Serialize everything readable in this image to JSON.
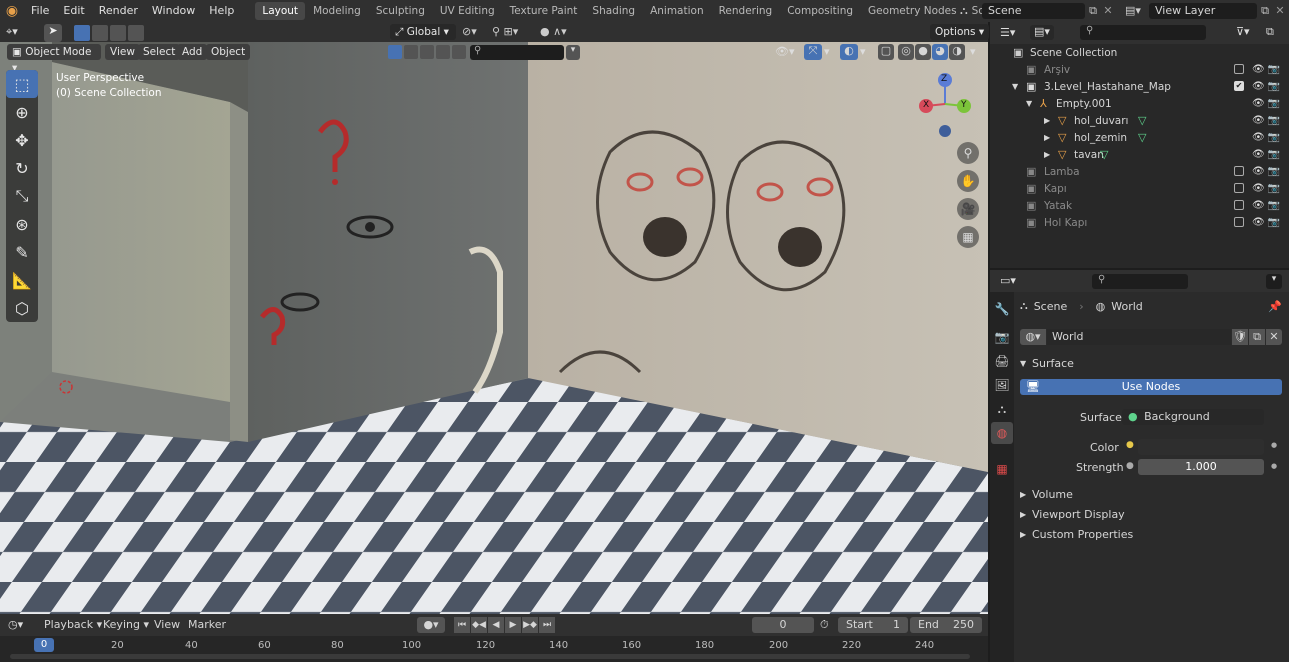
{
  "menubar": {
    "items": [
      "File",
      "Edit",
      "Render",
      "Window",
      "Help"
    ],
    "workspaces": [
      "Layout",
      "Modeling",
      "Sculpting",
      "UV Editing",
      "Texture Paint",
      "Shading",
      "Animation",
      "Rendering",
      "Compositing",
      "Geometry Nodes",
      "Scripting"
    ],
    "active_workspace": "Layout",
    "add_tab": "+",
    "scene_name": "Scene",
    "view_layer": "View Layer"
  },
  "viewport_header": {
    "mode": "Object Mode",
    "menus": [
      "View",
      "Select",
      "Add",
      "Object"
    ],
    "transform_orientation": "Global",
    "options": "Options"
  },
  "viewport": {
    "view_name": "User Perspective",
    "collection": "(0) Scene Collection",
    "gizmo_axes": {
      "x": "X",
      "y": "Y",
      "z": "Z"
    }
  },
  "outliner": {
    "root": "Scene Collection",
    "items": [
      {
        "label": "Arşiv",
        "indent": 0,
        "dim": true
      },
      {
        "label": "3.Level_Hastahane_Map",
        "indent": 0,
        "dim": false
      },
      {
        "label": "Empty.001",
        "indent": 1,
        "dim": false
      },
      {
        "label": "hol_duvarı",
        "indent": 2,
        "dim": false
      },
      {
        "label": "hol_zemin",
        "indent": 2,
        "dim": false
      },
      {
        "label": "tavan",
        "indent": 2,
        "dim": false
      },
      {
        "label": "Lamba",
        "indent": 0,
        "dim": true
      },
      {
        "label": "Kapı",
        "indent": 0,
        "dim": true
      },
      {
        "label": "Yatak",
        "indent": 0,
        "dim": true
      },
      {
        "label": "Hol Kapı",
        "indent": 0,
        "dim": true
      }
    ]
  },
  "properties": {
    "breadcrumb_scene": "Scene",
    "breadcrumb_world": "World",
    "world_name": "World",
    "surface_panel": "Surface",
    "use_nodes": "Use Nodes",
    "surface_label": "Surface",
    "surface_value": "Background",
    "color_label": "Color",
    "strength_label": "Strength",
    "strength_value": "1.000",
    "panels": [
      "Volume",
      "Viewport Display",
      "Custom Properties"
    ]
  },
  "timeline": {
    "menus": [
      "Playback",
      "Keying",
      "View",
      "Marker"
    ],
    "current_frame": "0",
    "start_label": "Start",
    "start_value": "1",
    "end_label": "End",
    "end_value": "250",
    "ticks": [
      "0",
      "20",
      "40",
      "60",
      "80",
      "100",
      "120",
      "140",
      "160",
      "180",
      "200",
      "220",
      "240"
    ]
  },
  "colors": {
    "accent": "#4772b3",
    "header": "#303030",
    "panel": "#2b2b2b",
    "object_orange": "#e8a14a",
    "mesh_green": "#5fd38d"
  }
}
